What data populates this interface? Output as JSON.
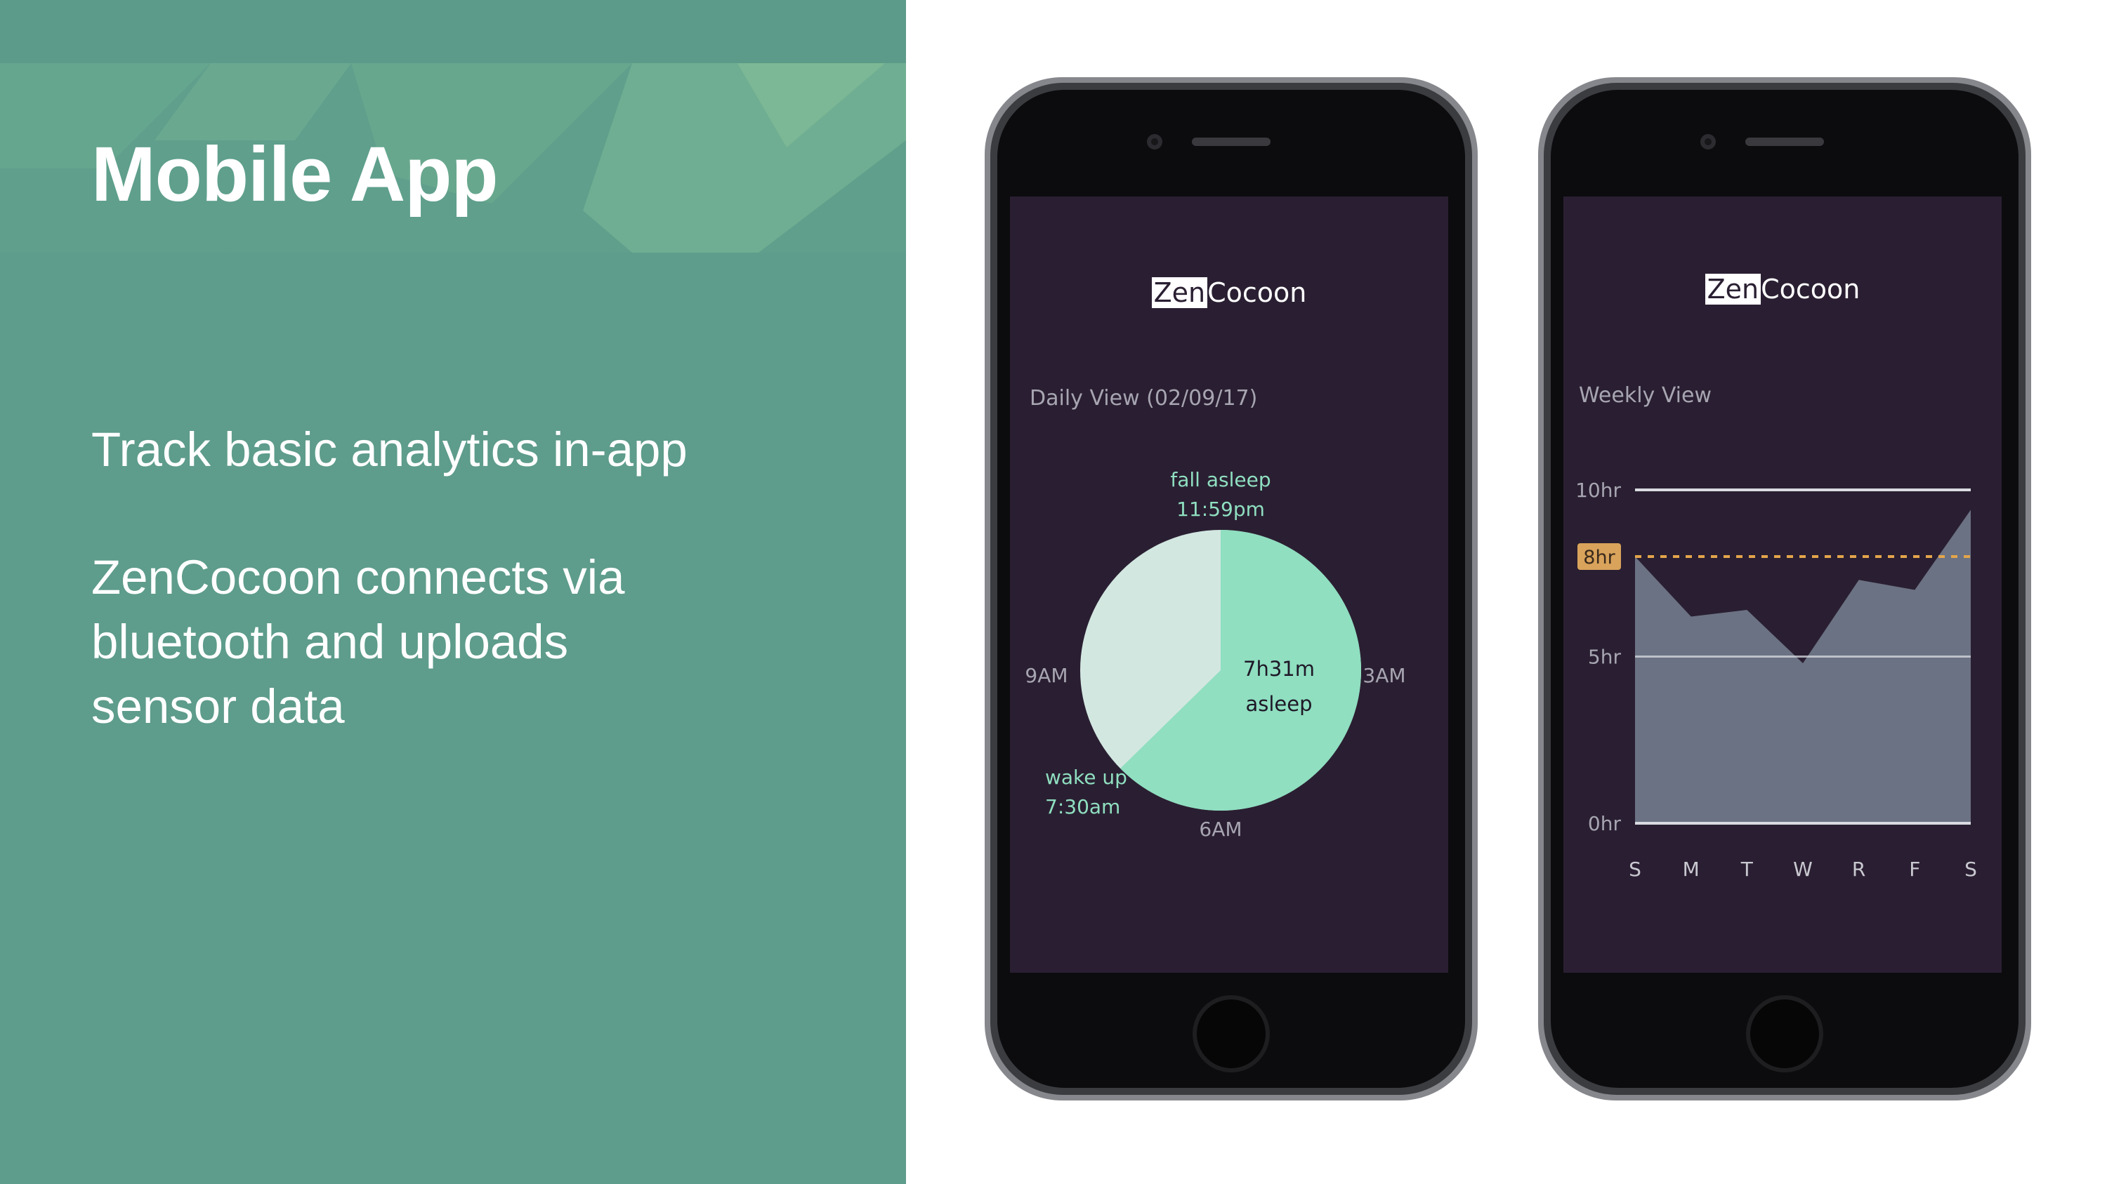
{
  "slide": {
    "title": "Mobile App",
    "bullet1": "Track basic analytics in-app",
    "bullet2_line1": "ZenCocoon connects via",
    "bullet2_line2": "bluetooth and uploads",
    "bullet2_line3": "sensor data"
  },
  "colors": {
    "panel_bg": "#5e9c8b",
    "screen_bg": "#2a1f32",
    "asleep": "#8fdfc0",
    "awake": "#d3e7e1",
    "area": "#6b7283",
    "target_line": "#e3a54b"
  },
  "daily_view": {
    "logo_zen": "Zen",
    "logo_cocoon": "Cocoon",
    "label": "Daily View (02/09/17)",
    "fall_asleep_label": "fall asleep",
    "fall_asleep_time": "11:59pm",
    "wake_up_label": "wake up",
    "wake_up_time": "7:30am",
    "duration": "7h31m",
    "duration_label": "asleep",
    "clock_labels": {
      "right": "3AM",
      "bottom": "6AM",
      "left": "9AM"
    }
  },
  "weekly_view": {
    "logo_zen": "Zen",
    "logo_cocoon": "Cocoon",
    "label": "Weekly View",
    "target_label": "8hr"
  },
  "chart_data": [
    {
      "type": "pie",
      "title": "Daily View (02/09/17)",
      "slices": [
        {
          "label": "asleep",
          "value": 7.52,
          "start": "11:59pm",
          "end": "7:30am"
        },
        {
          "label": "awake",
          "value": 4.48
        }
      ],
      "clock_labels": [
        "3AM",
        "6AM",
        "9AM"
      ],
      "center_text": "7h31m asleep"
    },
    {
      "type": "area",
      "title": "Weekly View",
      "categories": [
        "S",
        "M",
        "T",
        "W",
        "R",
        "F",
        "S"
      ],
      "values": [
        8.0,
        6.2,
        6.4,
        4.8,
        7.3,
        7.0,
        9.4
      ],
      "y_ticks": [
        "0hr",
        "5hr",
        "10hr"
      ],
      "ylim": [
        0,
        10
      ],
      "target": 8,
      "target_label": "8hr",
      "grid": true
    }
  ]
}
